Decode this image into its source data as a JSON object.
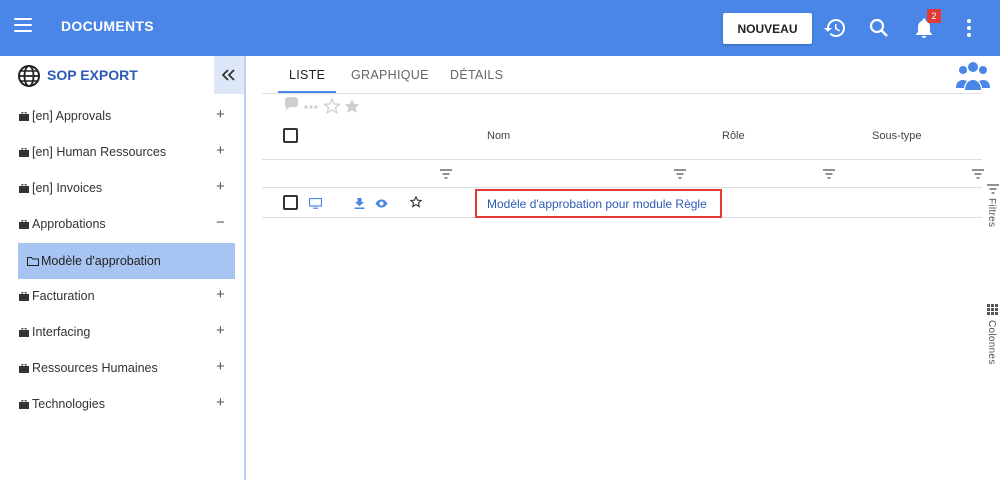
{
  "header": {
    "title": "DOCUMENTS",
    "new_button": "NOUVEAU",
    "notification_count": "2",
    "color": "#4a86e8"
  },
  "sidebar": {
    "title": "SOP EXPORT",
    "items": [
      {
        "label": "[en] Approvals",
        "toggle": "+"
      },
      {
        "label": "[en] Human Ressources",
        "toggle": "+"
      },
      {
        "label": "[en] Invoices",
        "toggle": "+"
      },
      {
        "label": "Approbations",
        "toggle": "−"
      },
      {
        "label": "Facturation",
        "toggle": "+"
      },
      {
        "label": "Interfacing",
        "toggle": "+"
      },
      {
        "label": "Ressources Humaines",
        "toggle": "+"
      },
      {
        "label": "Technologies",
        "toggle": "+"
      }
    ],
    "sub_item": "Modèle d'approbation",
    "selected_color": "#a8c4f2"
  },
  "tabs": [
    {
      "label": "LISTE",
      "active": true
    },
    {
      "label": "GRAPHIQUE",
      "active": false
    },
    {
      "label": "DÉTAILS",
      "active": false
    }
  ],
  "table": {
    "columns": [
      "Nom",
      "Rôle",
      "Sous-type"
    ],
    "rows": [
      {
        "name": "Modèle d'approbation pour module Règle"
      }
    ]
  },
  "side_panels": {
    "filters": "Filtres",
    "columns": "Colonnes"
  },
  "icons": [
    "menu-icon",
    "history-icon",
    "search-icon",
    "bell-icon",
    "more-vert-icon",
    "globe-icon",
    "double-chevron-left-icon",
    "briefcase-icon",
    "folder-icon",
    "group-icon",
    "comment-icon",
    "dots-icon",
    "star-outline-icon",
    "star-icon",
    "filter-icon",
    "monitor-icon",
    "download-icon",
    "eye-icon",
    "grid-icon"
  ]
}
